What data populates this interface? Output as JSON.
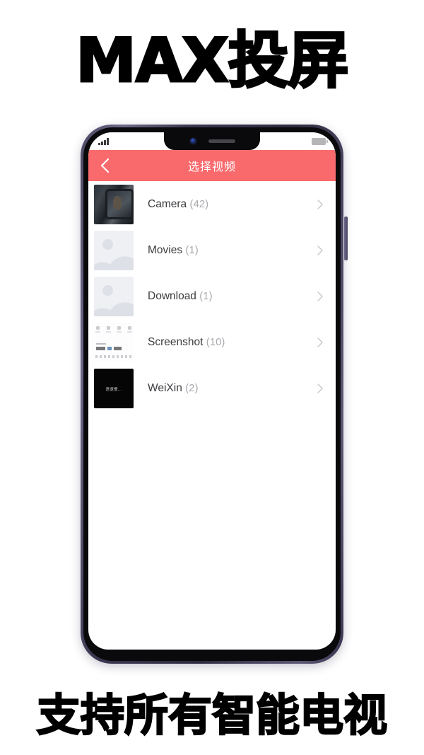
{
  "promo": {
    "headline": "MAX投屏",
    "subline": "支持所有智能电视"
  },
  "phone": {
    "statusbar": {
      "signal_icon": "signal-bars-icon",
      "battery_icon": "battery-icon"
    },
    "notch": {
      "camera_icon": "front-camera-icon",
      "speaker_icon": "earpiece-speaker-icon"
    },
    "appbar": {
      "back_icon": "chevron-left-icon",
      "title": "选择视频",
      "background_color": "#f96a6d",
      "title_color": "#ffffff"
    },
    "list": {
      "chevron_icon": "chevron-right-icon",
      "items": [
        {
          "name": "Camera",
          "count": "(42)",
          "thumb": "camera-photo-thumbnail"
        },
        {
          "name": "Movies",
          "count": "(1)",
          "thumb": "placeholder-image-thumbnail"
        },
        {
          "name": "Download",
          "count": "(1)",
          "thumb": "placeholder-image-thumbnail"
        },
        {
          "name": "Screenshot",
          "count": "(10)",
          "thumb": "screenshot-thumbnail"
        },
        {
          "name": "WeiXin",
          "count": "(2)",
          "thumb": "weixin-video-thumbnail"
        }
      ]
    }
  }
}
